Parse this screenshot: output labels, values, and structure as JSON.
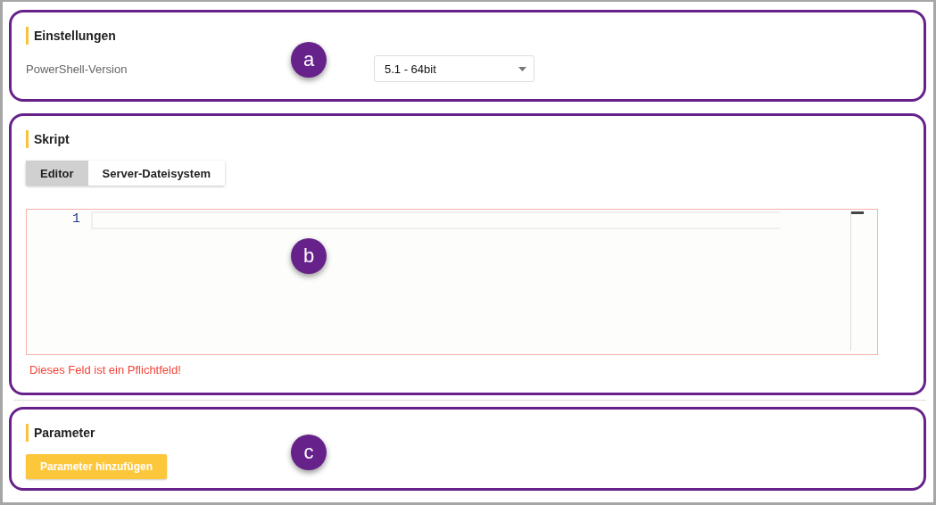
{
  "sections": [
    {
      "kind": "settings",
      "badge": "a",
      "title": "Einstellungen",
      "field_label": "PowerShell-Version",
      "select_value": "5.1 - 64bit"
    },
    {
      "kind": "script",
      "badge": "b",
      "title": "Skript",
      "tabs": [
        {
          "label": "Editor",
          "selected": true
        },
        {
          "label": "Server-Dateisystem",
          "selected": false
        }
      ],
      "line_numbers": [
        "1"
      ],
      "error": "Dieses Feld ist ein Pflichtfeld!"
    },
    {
      "kind": "parameters",
      "badge": "c",
      "title": "Parameter",
      "button": "Parameter hinzufügen"
    }
  ]
}
